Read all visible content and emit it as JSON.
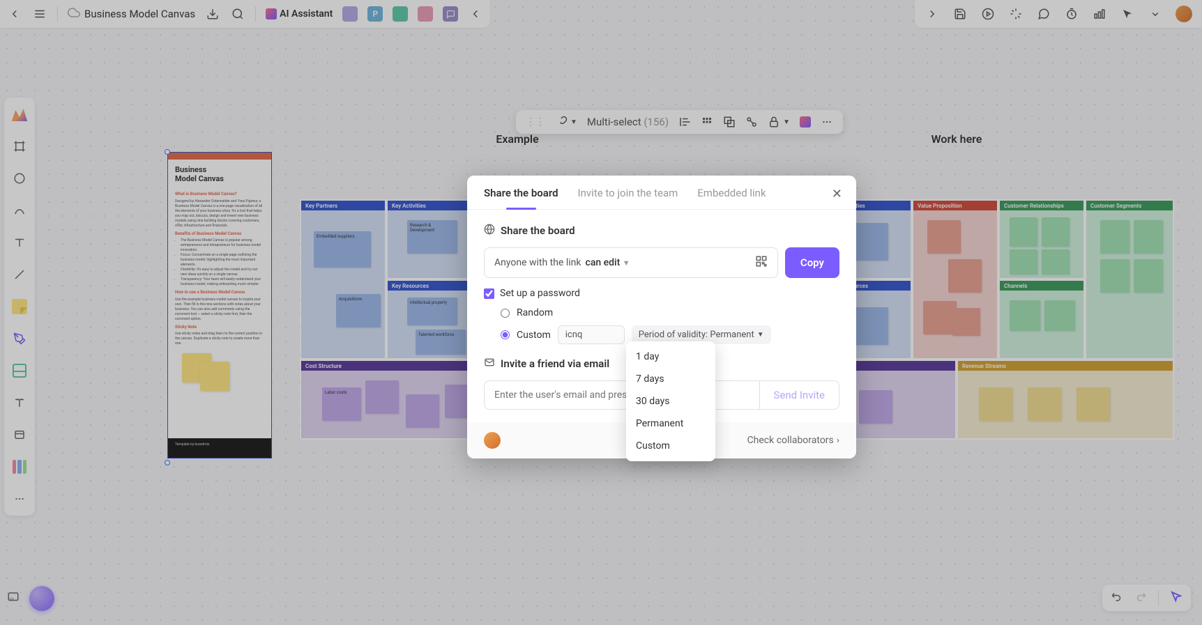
{
  "topbar": {
    "board_title": "Business Model Canvas",
    "ai_assistant": "AI Assistant",
    "user_badges": [
      "",
      "P",
      "",
      "",
      ""
    ]
  },
  "context_bar": {
    "multi_select_label": "Multi-select",
    "multi_select_count": "(156)"
  },
  "canvas": {
    "doc_frame": {
      "title": "Business\nModel Canvas",
      "h1": "What is Business Model Canvas?",
      "p1": "Designed by Alexander Osterwalder and Yves Pigneur, a Business Model Canvas is a one-page visualization of all the elements of your business story. It's a tool that helps you map out, discuss, design and invent new business models using nine building blocks covering customers, offer, infrastructure and financials.",
      "h2": "Benefits of Business Model Canvas",
      "bullets": [
        "The Business Model Canvas is popular among entrepreneurs and intrapreneurs for business model innovation.",
        "Focus: Concentrate on a single page outlining the business model, highlighting the most important elements.",
        "Flexibility: It's easy to adjust the model and try out new ideas quickly on a single canvas.",
        "Transparency: Your team will easily understand your business model, making onboarding much simpler."
      ],
      "h3": "How to use a Business Model Canvas",
      "p3": "Use the example business model canvas to inspire your own. Then fill in the nine sections with notes about your business. You can also add comments using the comment tool — select a sticky note first, then the comment option.",
      "sticky_title": "Sticky Note",
      "sticky_hint": "Use sticky notes and drag them to the correct position in the canvas. Duplicate a sticky note to create more than one.",
      "footer": "Template by  boardmix"
    },
    "example_title": "Example",
    "work_title": "Work here",
    "cells": {
      "key_partners": "Key Partners",
      "key_activities": "Key Activities",
      "key_resources": "Key Resources",
      "value_prop": "Value Proposition",
      "cust_rel": "Customer Relationships",
      "channels": "Channels",
      "cust_seg": "Customer Segments",
      "cost": "Cost Structure",
      "revenue": "Revenue Streams"
    },
    "stickies": {
      "ex_partners": "Embedded suppliers",
      "ex_act1": "Research & Development",
      "ex_act2": "Acquisitions",
      "ex_res1": "Intellectual property",
      "ex_res2": "Talented workforce",
      "ex_cost": "Labor costs"
    }
  },
  "modal": {
    "tabs": {
      "share": "Share the board",
      "invite": "Invite to join the team",
      "embed": "Embedded link"
    },
    "share_section": "Share the board",
    "anyone_link": "Anyone with the link",
    "permission": "can edit",
    "copy": "Copy",
    "setup_password": "Set up a password",
    "random": "Random",
    "custom": "Custom",
    "password_value": "icnq",
    "validity_label": "Period of validity: Permanent",
    "invite_section": "Invite a friend via email",
    "email_placeholder": "Enter the user's email and press Enter to confirm",
    "send_invite": "Send Invite",
    "check_collaborators": "Check collaborators"
  },
  "dropdown": {
    "options": [
      "1 day",
      "7 days",
      "30 days",
      "Permanent",
      "Custom"
    ]
  }
}
